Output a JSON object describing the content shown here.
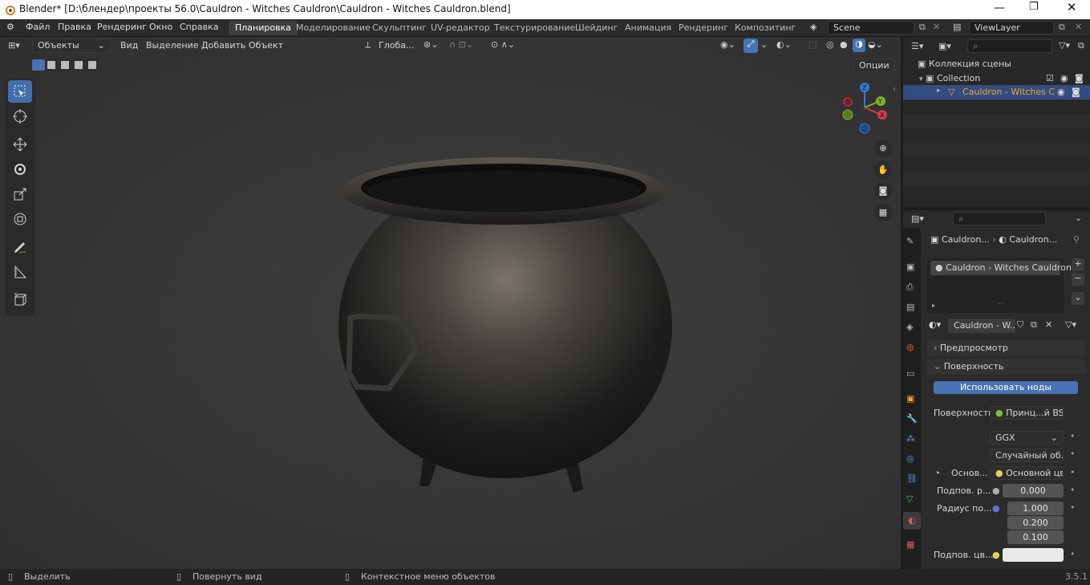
{
  "titlebar": {
    "title": "Blender* [D:\\блендер\\проекты 56.0\\Cauldron - Witches Cauldron\\Cauldron - Witches Cauldron.blend]"
  },
  "menu": {
    "items": [
      "Файл",
      "Правка",
      "Рендеринг",
      "Окно",
      "Справка"
    ]
  },
  "workspaces": [
    "Планировка",
    "Моделирование",
    "Скульптинг",
    "UV-редактор",
    "Текстурирование",
    "Шейдинг",
    "Анимация",
    "Рендеринг",
    "Композитинг"
  ],
  "scene": {
    "name": "Scene",
    "view_layer": "ViewLayer"
  },
  "viewport_header": {
    "mode": "Объекты",
    "menus": [
      "Вид",
      "Выделение",
      "Добавить",
      "Объект"
    ],
    "orientation": "Глоба...",
    "options": "Опции"
  },
  "outliner": {
    "root": "Коллекция сцены",
    "collection": "Collection",
    "object": "Cauldron - Witches C"
  },
  "properties": {
    "breadcrumb_object": "Cauldron...",
    "breadcrumb_material": "Cauldron...",
    "slot_name": "Cauldron - Witches Cauldron",
    "material_name": "Cauldron - W...",
    "panel_preview": "Предпросмотр",
    "panel_surface": "Поверхность",
    "use_nodes_button": "Использовать ноды",
    "surface_label": "Поверхность",
    "surface_value": "Принц...й BSDF",
    "distribution": "GGX",
    "subsurface_method": "Случайный об...",
    "base_label": "Основ...",
    "base_value": "Основной цвет",
    "subsurface_label": "Подпов. р...",
    "subsurface_value": "0.000",
    "radius_label": "Радиус по...",
    "radius_values": [
      "1.000",
      "0.200",
      "0.100"
    ],
    "subsurface_color_label": "Подпов. цв..."
  },
  "statusbar": {
    "select": "Выделить",
    "rotate": "Повернуть вид",
    "context": "Контекстное меню объектов",
    "version": "3.5.1"
  },
  "colors": {
    "accent": "#4772b3",
    "active_object": "#f0a030"
  }
}
